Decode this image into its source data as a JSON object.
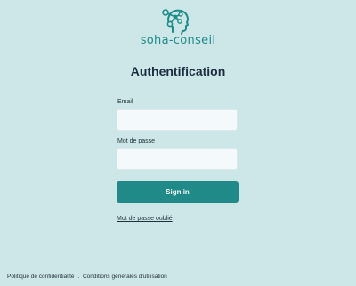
{
  "brand": {
    "name": "soha-conseil",
    "icon": "head-network-icon",
    "color": "#1e8c89"
  },
  "page": {
    "title": "Authentification",
    "background": "#cde6e8"
  },
  "form": {
    "email_label": "Email",
    "email_value": "",
    "password_label": "Mot de passe",
    "password_value": "",
    "submit_label": "Sign in",
    "submit_color": "#1f8a87",
    "forgot_label": "Mot de passe oublié"
  },
  "footer": {
    "privacy_label": "Politique de confidentialité",
    "separator": ".",
    "terms_label": "Conditions générales d'utilisation"
  }
}
